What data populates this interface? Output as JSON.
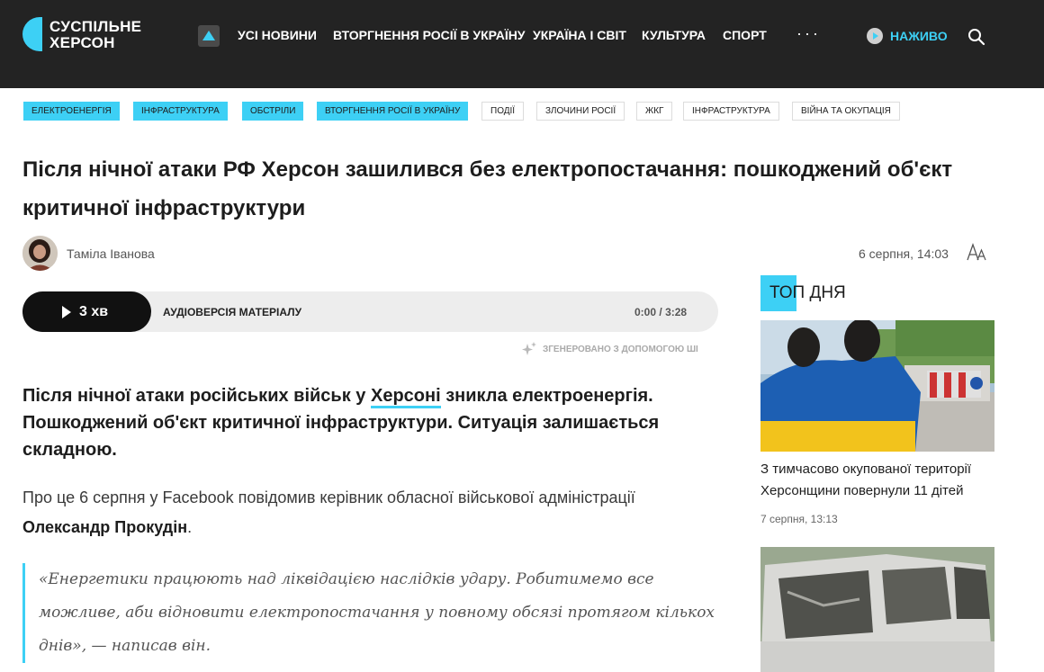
{
  "brand": {
    "name_line1": "СУСПІЛЬНЕ",
    "name_line2": "ХЕРСОН",
    "accent": "#3dd0f5"
  },
  "nav": {
    "items": [
      {
        "label": "УСІ НОВИНИ"
      },
      {
        "label": "ВТОРГНЕННЯ РОСІЇ В УКРАЇНУ"
      },
      {
        "label": "УКРАЇНА І СВІТ"
      },
      {
        "label": "КУЛЬТУРА"
      },
      {
        "label": "СПОРТ"
      }
    ],
    "more": "···",
    "live_label": "НАЖИВО"
  },
  "tags": [
    {
      "label": "Електроенергія"
    },
    {
      "label": "Інфраструктура"
    },
    {
      "label": "Обстріли"
    },
    {
      "label": "Вторгнення Росії в Україну"
    },
    {
      "label": "Події"
    },
    {
      "label": "Злочини Росії"
    },
    {
      "label": "ЖКГ"
    },
    {
      "label": "Інфраструктура"
    },
    {
      "label": "Війна та окупація"
    }
  ],
  "article": {
    "title": "Після нічної атаки РФ Херсон зашилився без електропостачання: пошкоджений об'єкт критичної інфраструктури",
    "author": "Таміла Іванова",
    "date": "6 серпня, 14:03",
    "audio": {
      "duration_label": "3 хв",
      "label": "Аудіоверсія матеріалу",
      "current": "0:00",
      "separator": "/",
      "total": "3:28",
      "ai_note": "Згенеровано з допомогою ШІ"
    },
    "lead_before": "Після нічної атаки російських військ у ",
    "lead_link": "Херсоні",
    "lead_after": " зникла електроенергія. Пошкоджений об'єкт критичної інфраструктури. Ситуація залишається складною.",
    "para_text": "Про це 6 серпня у Facebook повідомив керівник обласної військової адміністрації ",
    "para_bold": "Олександр Прокудін",
    "para_end": ".",
    "quote": "«Енергетики працюють над ліквідацією наслідків удару. Робитимемо все можливе, аби відновити електропостачання у повному обсязі протягом кількох днів», — написав він."
  },
  "sidebar": {
    "heading": "ТОП ДНЯ",
    "cards": [
      {
        "title": "З тимчасово окупованої території Херсонщини повернули 11 дітей",
        "date": "7 серпня, 13:13"
      }
    ]
  }
}
